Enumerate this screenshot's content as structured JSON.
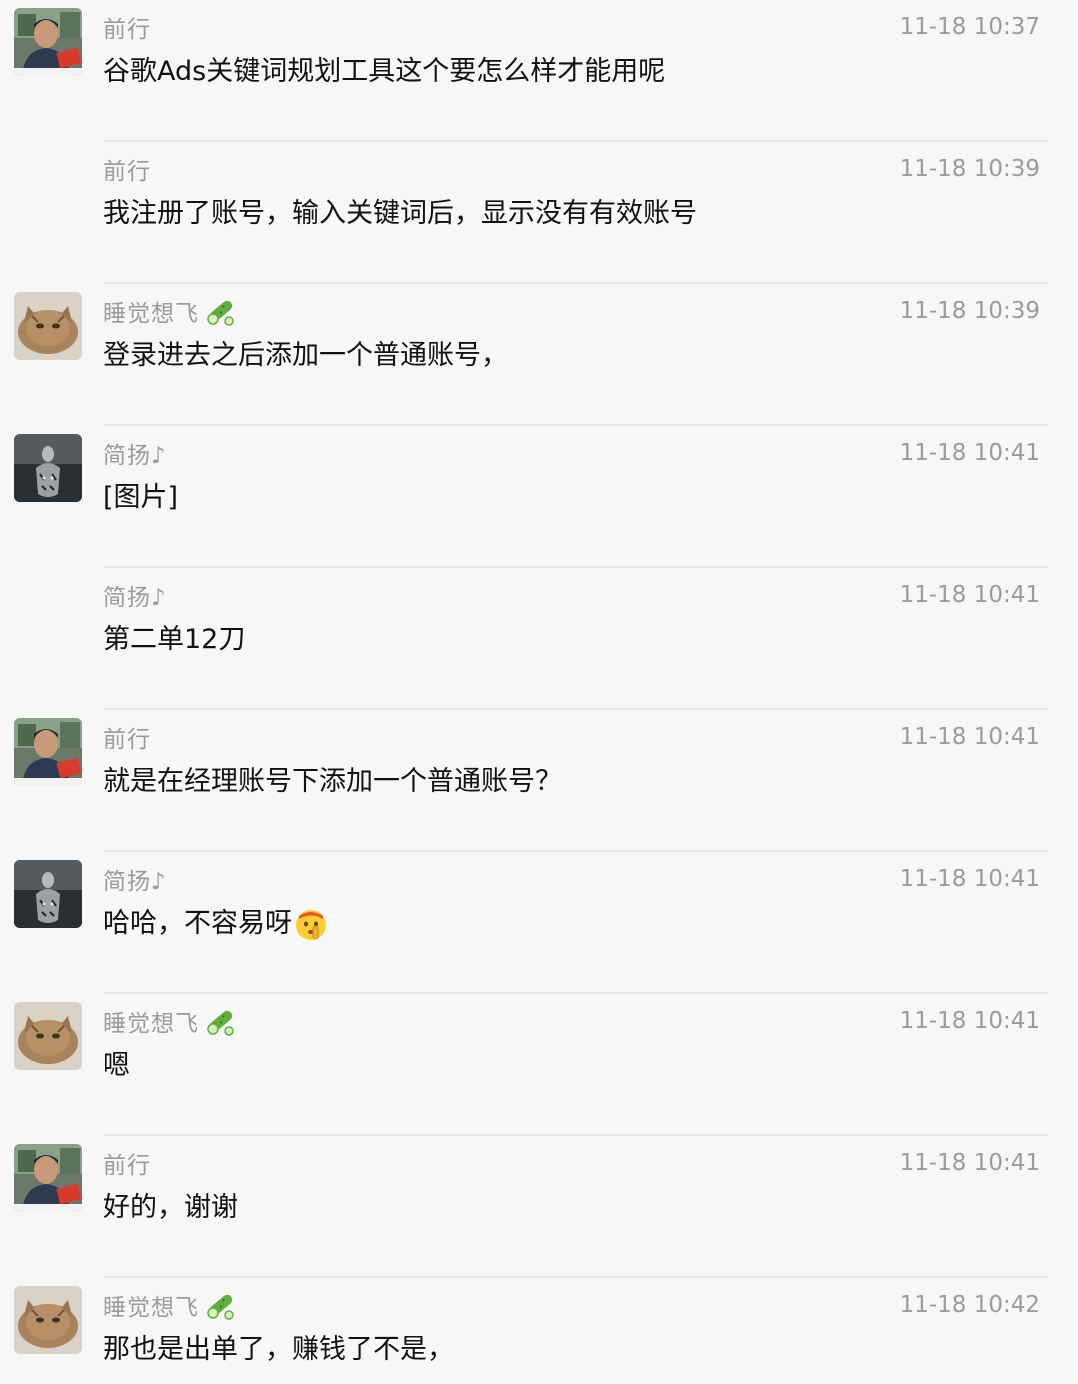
{
  "messages": [
    {
      "sender": "前行",
      "time": "11-18 10:37",
      "text": "谷歌Ads关键词规划工具这个要怎么样才能用呢",
      "avatar": "person-avatar",
      "show_avatar": true,
      "badge": "",
      "emoji": ""
    },
    {
      "sender": "前行",
      "time": "11-18 10:39",
      "text": "我注册了账号，输入关键词后，显示没有有效账号",
      "avatar": "person-avatar",
      "show_avatar": false,
      "badge": "",
      "emoji": ""
    },
    {
      "sender": "睡觉想飞",
      "time": "11-18 10:39",
      "text": "登录进去之后添加一个普通账号，",
      "avatar": "cat-avatar",
      "show_avatar": true,
      "badge": "cucumber-icon",
      "emoji": ""
    },
    {
      "sender": "简扬♪",
      "time": "11-18 10:41",
      "text": "[图片]",
      "avatar": "tiger-avatar",
      "show_avatar": true,
      "badge": "",
      "emoji": ""
    },
    {
      "sender": "简扬♪",
      "time": "11-18 10:41",
      "text": "第二单12刀",
      "avatar": "tiger-avatar",
      "show_avatar": false,
      "badge": "",
      "emoji": ""
    },
    {
      "sender": "前行",
      "time": "11-18 10:41",
      "text": "就是在经理账号下添加一个普通账号？",
      "avatar": "person-avatar",
      "show_avatar": true,
      "badge": "",
      "emoji": ""
    },
    {
      "sender": "简扬♪",
      "time": "11-18 10:41",
      "text": "哈哈，不容易呀",
      "avatar": "tiger-avatar",
      "show_avatar": true,
      "badge": "",
      "emoji": "shush-face-emoji"
    },
    {
      "sender": "睡觉想飞",
      "time": "11-18 10:41",
      "text": "嗯",
      "avatar": "cat-avatar",
      "show_avatar": true,
      "badge": "cucumber-icon",
      "emoji": ""
    },
    {
      "sender": "前行",
      "time": "11-18 10:41",
      "text": "好的，谢谢",
      "avatar": "person-avatar",
      "show_avatar": true,
      "badge": "",
      "emoji": ""
    },
    {
      "sender": "睡觉想飞",
      "time": "11-18 10:42",
      "text": "那也是出单了，赚钱了不是，",
      "avatar": "cat-avatar",
      "show_avatar": true,
      "badge": "cucumber-icon",
      "emoji": ""
    }
  ],
  "colors": {
    "background": "#f7f7f7",
    "meta_text": "#9b9b9b",
    "message_text": "#111111",
    "divider": "#e4e4e4"
  }
}
